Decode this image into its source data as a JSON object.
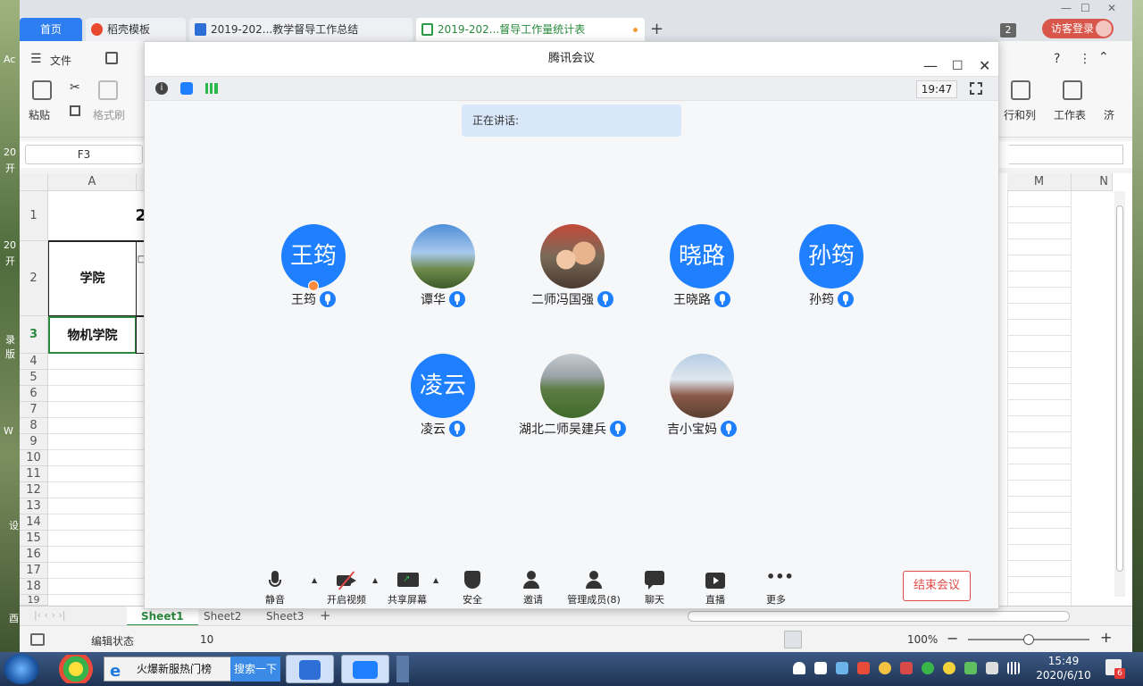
{
  "wps": {
    "tabs": [
      {
        "label": "首页"
      },
      {
        "label": "稻壳模板"
      },
      {
        "label": "2019-202...教学督导工作总结"
      },
      {
        "label": "2019-202...督导工作量统计表"
      }
    ],
    "tab_count_badge": "2",
    "visitor_login": "访客登录",
    "file_menu": "文件",
    "toolbar": {
      "paste": "粘贴",
      "format_painter": "格式刷",
      "rows_cols": "行和列",
      "worksheet": "工作表",
      "more_cut": "济"
    },
    "namebox": "F3",
    "columns": [
      "A",
      "M",
      "N"
    ],
    "rows": [
      "1",
      "2",
      "3",
      "4",
      "5",
      "6",
      "7",
      "8",
      "9",
      "10",
      "11",
      "12",
      "13",
      "14",
      "15",
      "16",
      "17",
      "18",
      "19"
    ],
    "cells": {
      "a2": "学院",
      "a3": "物机学院",
      "b1_partial": "2",
      "b2_partial": "□"
    },
    "sheets": [
      "Sheet1",
      "Sheet2",
      "Sheet3"
    ],
    "status": {
      "mode": "编辑状态",
      "value": "10",
      "zoom": "100%"
    }
  },
  "meeting": {
    "title": "腾讯会议",
    "time": "19:47",
    "speaking_label": "正在讲话:",
    "participants": [
      {
        "avatar_text": "王筠",
        "name": "王筠",
        "host": true,
        "photo": false
      },
      {
        "avatar_text": "",
        "name": "谭华",
        "host": false,
        "photo": true
      },
      {
        "avatar_text": "",
        "name": "二师冯国强",
        "host": false,
        "photo": true
      },
      {
        "avatar_text": "晓路",
        "name": "王晓路",
        "host": false,
        "photo": false
      },
      {
        "avatar_text": "孙筠",
        "name": "孙筠",
        "host": false,
        "photo": false
      },
      {
        "avatar_text": "凌云",
        "name": "凌云",
        "host": false,
        "photo": false
      },
      {
        "avatar_text": "",
        "name": "湖北二师吴建兵",
        "host": false,
        "photo": true
      },
      {
        "avatar_text": "",
        "name": "吉小宝妈",
        "host": false,
        "photo": true
      }
    ],
    "controls": {
      "mute": "静音",
      "video": "开启视频",
      "share": "共享屏幕",
      "security": "安全",
      "invite": "邀请",
      "members": "管理成员(8)",
      "chat": "聊天",
      "live": "直播",
      "more": "更多",
      "end": "结束会议"
    },
    "accent_color": "#1f80ff",
    "end_color": "#e24a4a"
  },
  "taskbar": {
    "ie_text": "火爆新服热门榜",
    "ie_search": "搜索一下",
    "time": "15:49",
    "date": "2020/6/10",
    "notify_badge": "6"
  },
  "desktop": {
    "left_labels": [
      "Ac",
      "20",
      "开",
      "20",
      "开",
      "录",
      "版",
      "W",
      "设",
      "酉"
    ]
  }
}
